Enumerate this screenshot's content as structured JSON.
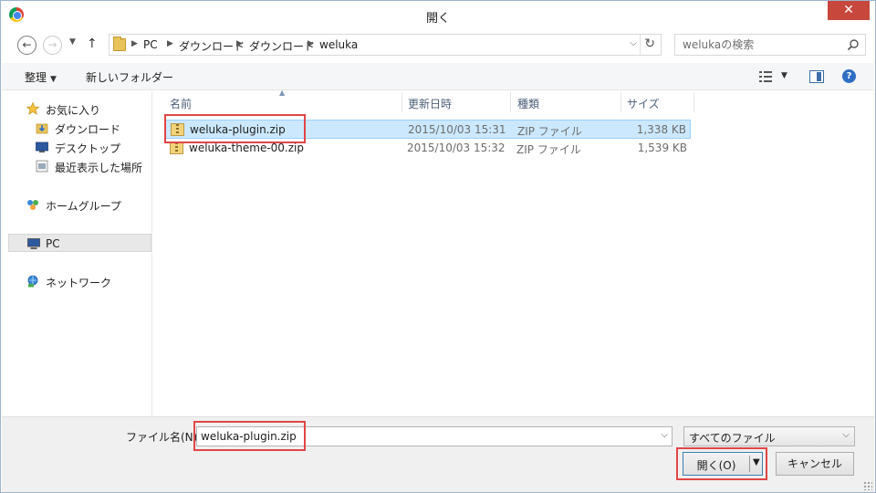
{
  "window": {
    "title": "開く",
    "close_label": "✕"
  },
  "address": {
    "crumbs": [
      "PC",
      "ダウンロード",
      "ダウンロード",
      "weluka"
    ]
  },
  "search": {
    "placeholder": "welukaの検索"
  },
  "toolbar": {
    "organize_label": "整理",
    "new_folder_label": "新しいフォルダー"
  },
  "sidebar": {
    "items": [
      {
        "label": "お気に入り"
      },
      {
        "label": "ダウンロード"
      },
      {
        "label": "デスクトップ"
      },
      {
        "label": "最近表示した場所"
      },
      {
        "label": "ホームグループ"
      },
      {
        "label": "PC"
      },
      {
        "label": "ネットワーク"
      }
    ]
  },
  "columns": {
    "name": "名前",
    "modified": "更新日時",
    "type": "種類",
    "size": "サイズ"
  },
  "files": [
    {
      "name": "weluka-plugin.zip",
      "modified": "2015/10/03 15:31",
      "type": "ZIP ファイル",
      "size": "1,338 KB",
      "selected": true
    },
    {
      "name": "weluka-theme-00.zip",
      "modified": "2015/10/03 15:32",
      "type": "ZIP ファイル",
      "size": "1,539 KB",
      "selected": false
    }
  ],
  "footer": {
    "filename_label": "ファイル名(N):",
    "filename_value": "weluka-plugin.zip",
    "filetype_value": "すべてのファイル",
    "open_label": "開く(O)",
    "cancel_label": "キャンセル"
  }
}
